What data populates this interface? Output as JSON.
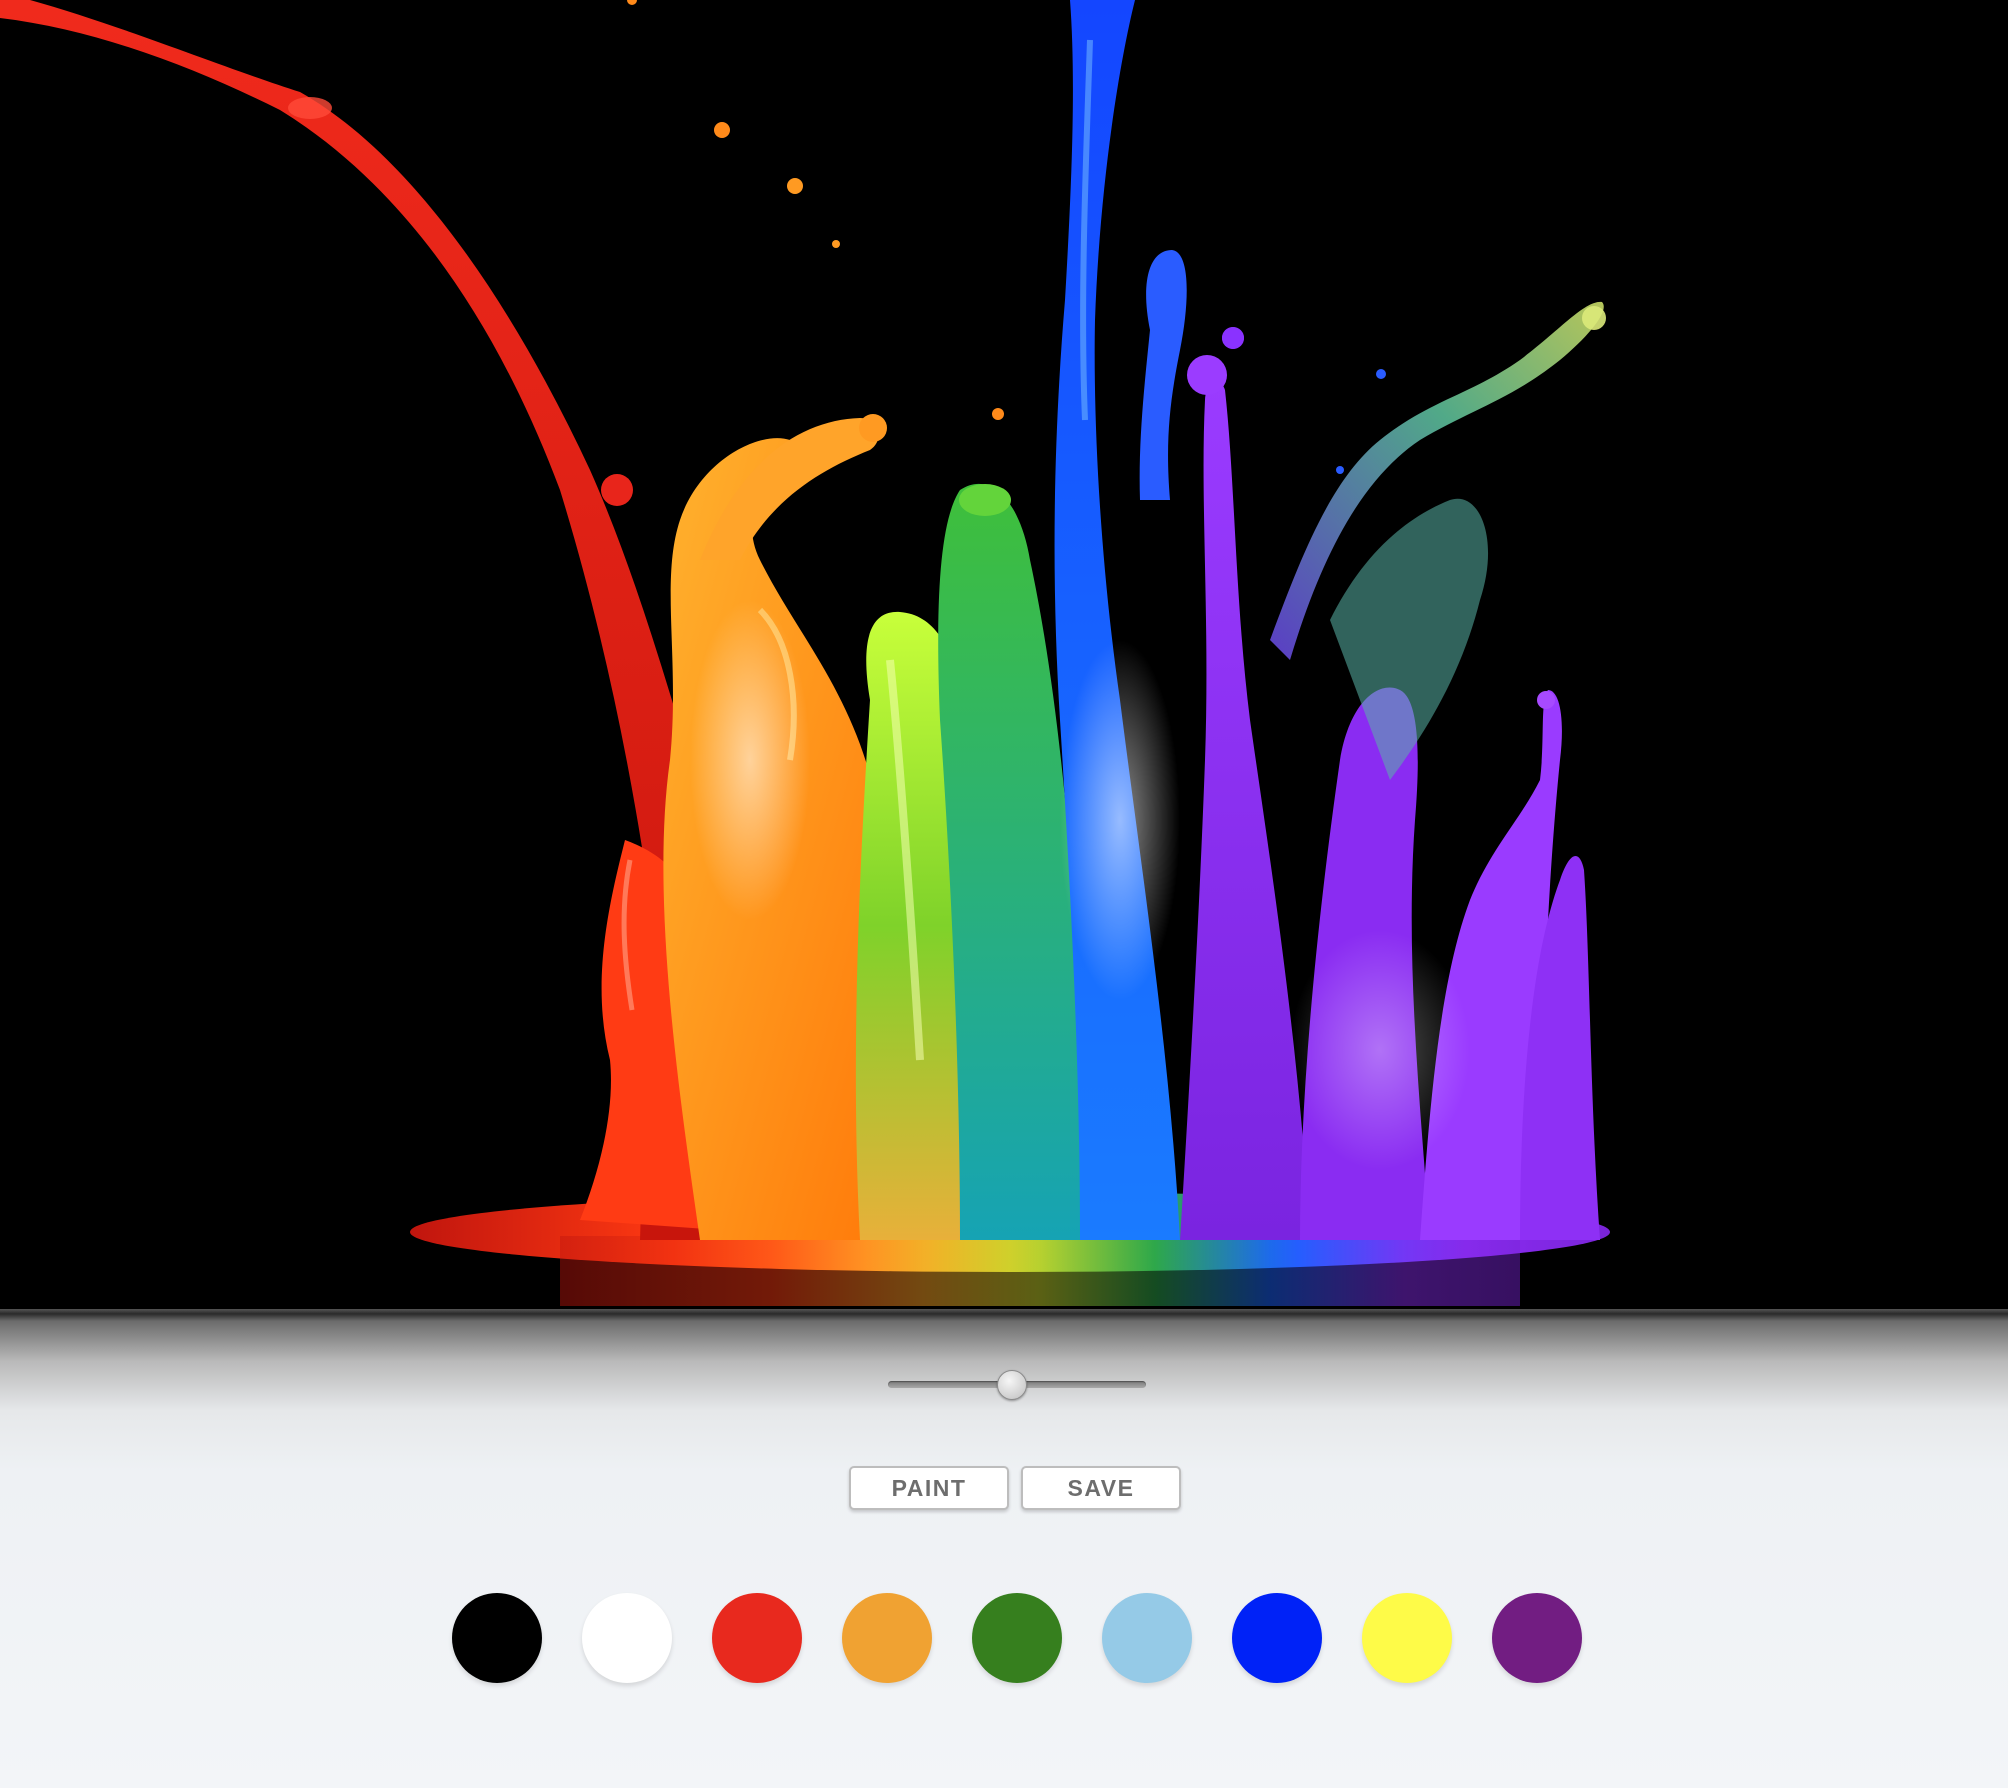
{
  "toolbar": {
    "paint_label": "PAINT",
    "save_label": "SAVE"
  },
  "brush_slider": {
    "min": 0,
    "max": 100,
    "value": 48
  },
  "palette": [
    {
      "name": "black",
      "color": "#000000"
    },
    {
      "name": "white",
      "color": "#ffffff"
    },
    {
      "name": "red",
      "color": "#e8291e"
    },
    {
      "name": "orange",
      "color": "#f0a232"
    },
    {
      "name": "green",
      "color": "#367f1e"
    },
    {
      "name": "light-blue",
      "color": "#95cae7"
    },
    {
      "name": "blue",
      "color": "#0022f7"
    },
    {
      "name": "yellow",
      "color": "#fefb48"
    },
    {
      "name": "purple",
      "color": "#721d82"
    }
  ],
  "canvas": {
    "background": "#000000",
    "image": "rainbow-paint-splash"
  }
}
